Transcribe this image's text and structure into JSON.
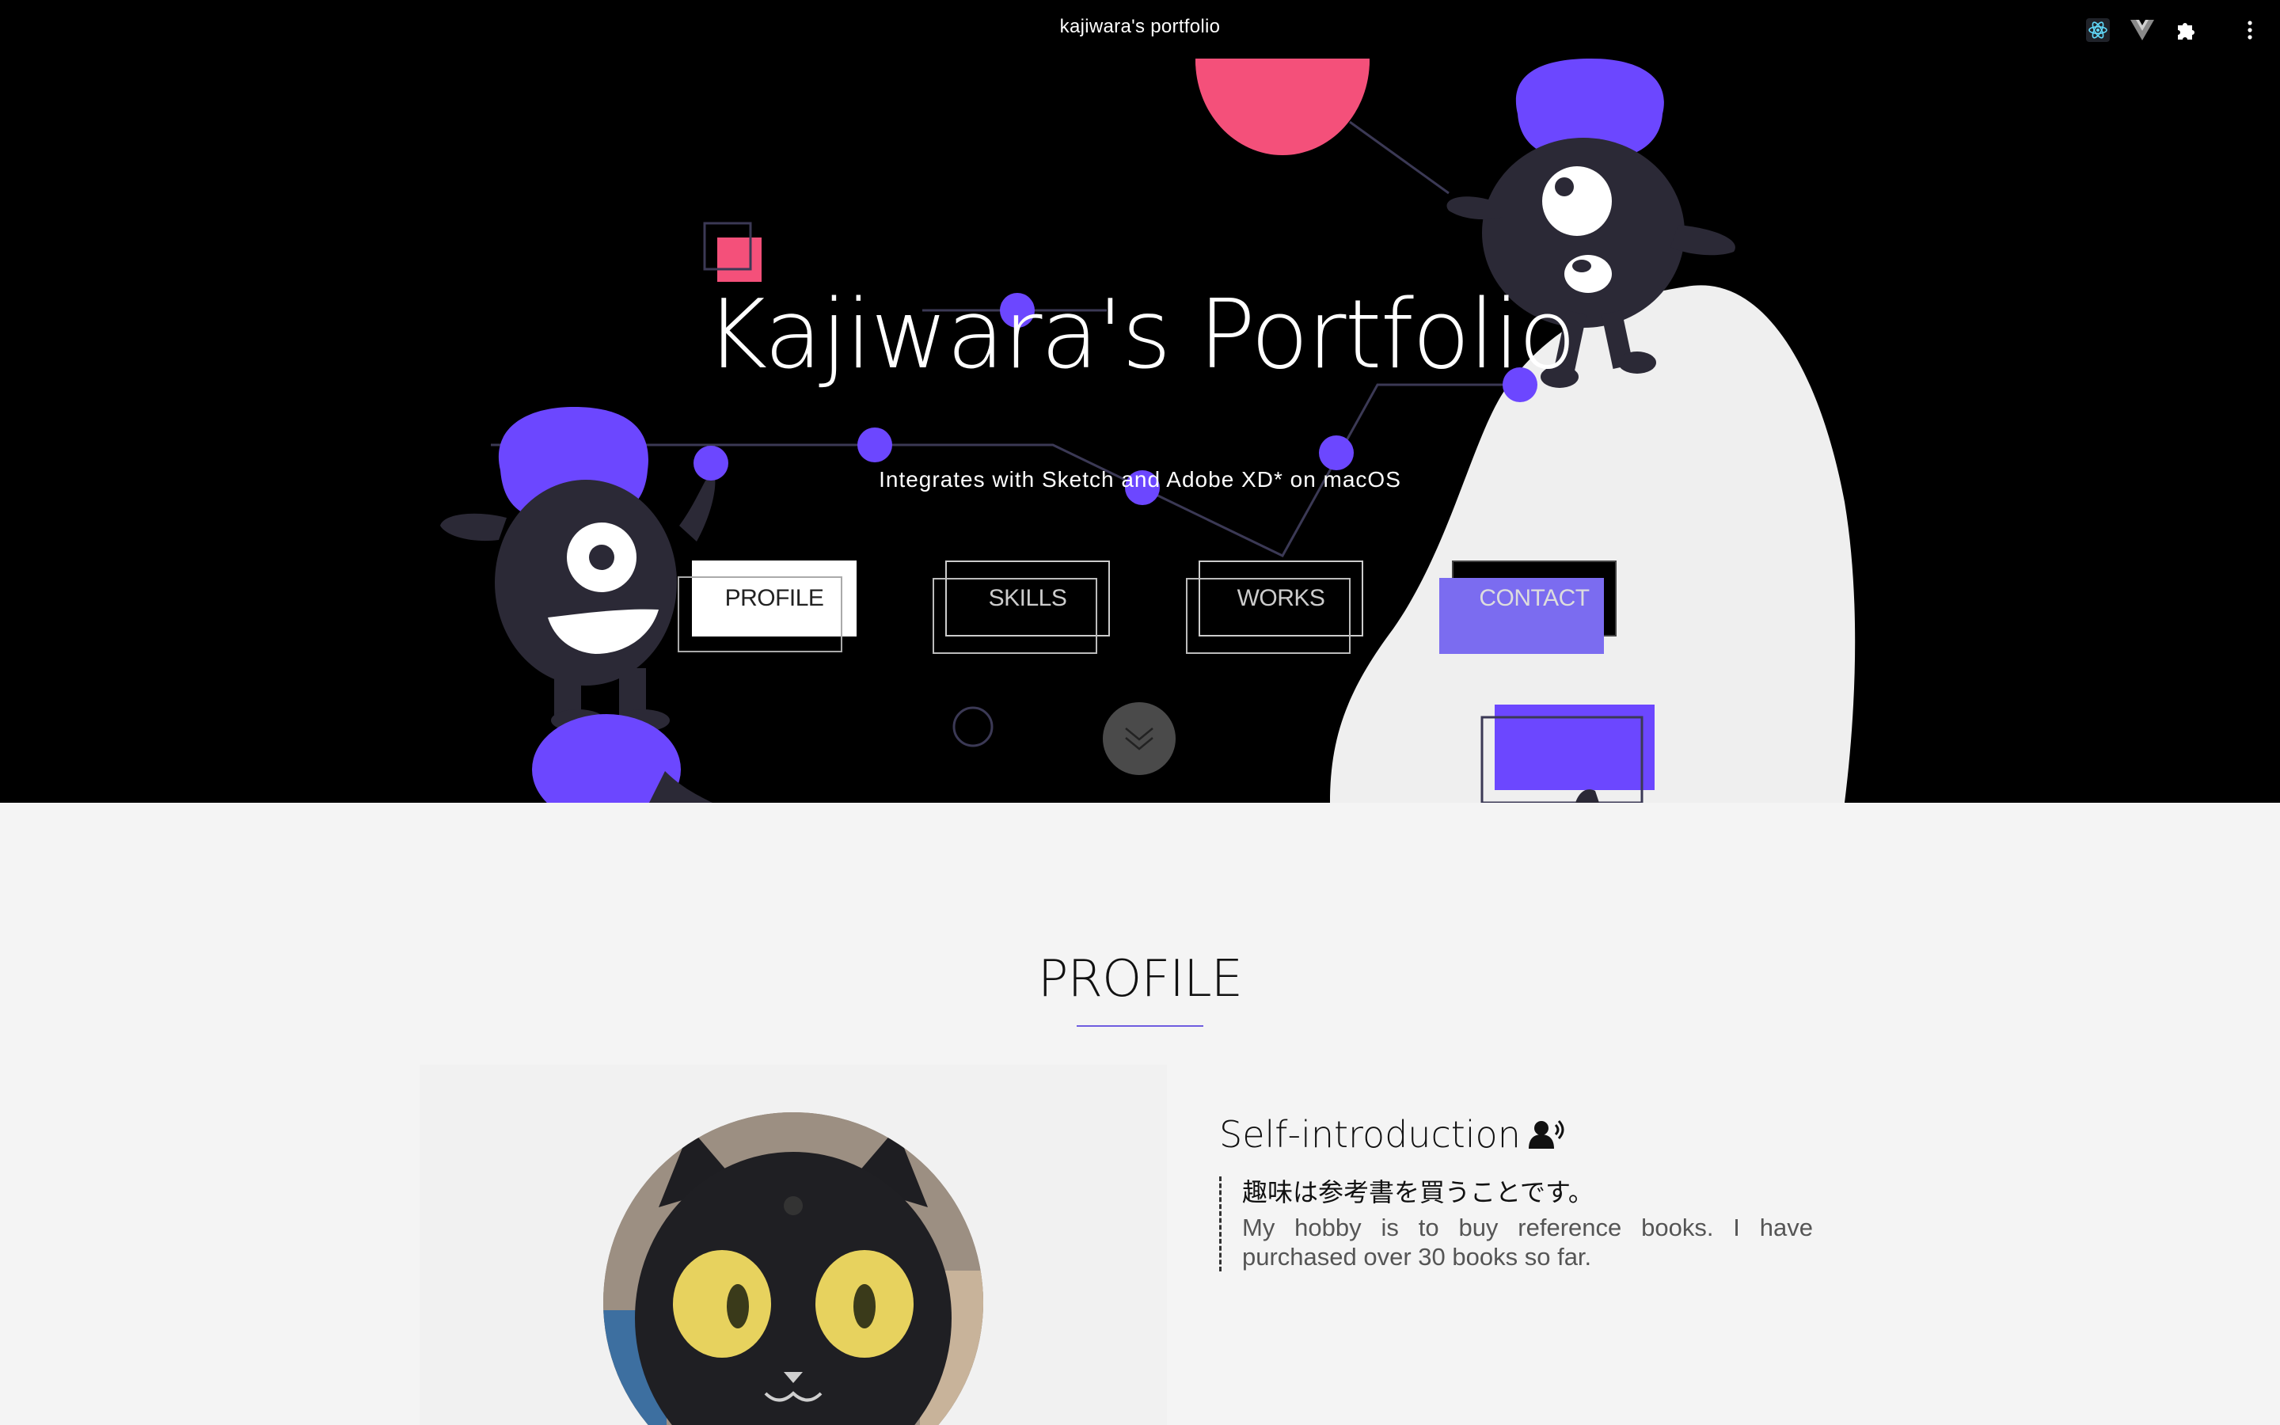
{
  "window": {
    "title": "kajiwara's portfolio",
    "extensions": [
      "react-devtools-icon",
      "vue-devtools-icon",
      "extensions-puzzle-icon",
      "more-menu-icon"
    ]
  },
  "hero": {
    "title": "Kajiwara's Portfolio",
    "subtitle": "Integrates with Sketch and Adobe XD* on macOS",
    "nav": [
      {
        "label": "PROFILE"
      },
      {
        "label": "SKILLS"
      },
      {
        "label": "WORKS"
      },
      {
        "label": "CONTACT"
      }
    ],
    "scroll_icon": "chevron-down-icon"
  },
  "profile": {
    "heading": "PROFILE",
    "intro_title": "Self-introduction",
    "intro_icon": "person-speaking-icon",
    "intro_jp": "趣味は参考書を買うことです。",
    "intro_en": "My hobby is to buy reference books. I have purchased over 30 books so far."
  },
  "colors": {
    "accent": "#6c47ff",
    "pink": "#f4507a",
    "character": "#2b2936",
    "hero_bg": "#000000",
    "section_bg": "#f4f4f4"
  }
}
